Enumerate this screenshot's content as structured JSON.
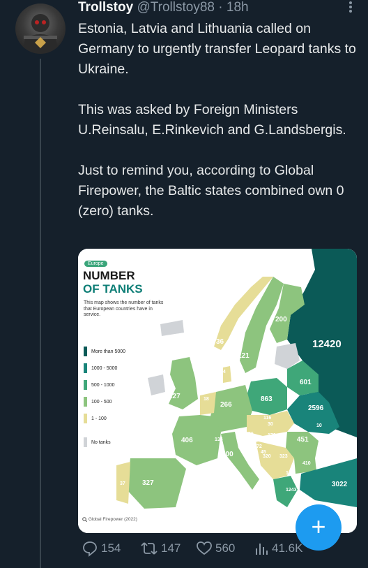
{
  "tweet": {
    "display_name": "Trollstoy",
    "handle": "@Trollstoy88",
    "separator": "·",
    "time": "18h",
    "text": "Estonia, Latvia and Lithuania called on Germany to urgently transfer Leopard tanks to Ukraine.\n\nThis was asked by Foreign Ministers U.Reinsalu, E.Rinkevich and G.Landsbergis.\n\nJust to remind you, according to Global Firepower, the Baltic states combined own 0 (zero) tanks."
  },
  "map": {
    "badge": "Europe",
    "title_line1": "NUMBER",
    "title_line2": "OF TANKS",
    "description": "This map shows the number of tanks that European countries have in service.",
    "legend": [
      {
        "label": "More than 5000",
        "color": "#0b5a57"
      },
      {
        "label": "1000 - 5000",
        "color": "#19847a"
      },
      {
        "label": "500 - 1000",
        "color": "#3fa779"
      },
      {
        "label": "100 - 500",
        "color": "#8dc47e"
      },
      {
        "label": "1 - 100",
        "color": "#e6dd97"
      },
      {
        "label": "No tanks",
        "color": "#d0d3d7"
      }
    ],
    "values": {
      "russia": "12420",
      "finland": "200",
      "sweden": "121",
      "norway": "36",
      "denmark": "44",
      "uk": "227",
      "ireland": "0",
      "netherlands": "18",
      "germany": "266",
      "poland": "863",
      "belarus": "601",
      "ukraine": "2596",
      "france": "406",
      "spain": "327",
      "portugal": "37",
      "italy": "200",
      "czechia": "116",
      "slovakia": "30",
      "austria": "56",
      "switzerland": "134",
      "hungary": "176",
      "romania": "451",
      "moldova": "10",
      "serbia": "320",
      "bulgaria": "410",
      "n_macedonia": "10",
      "greece": "1243",
      "turkey": "3022",
      "slovenia": "14",
      "croatia": "72",
      "bosnia": "45",
      "montenegro": "323"
    },
    "source": "Global Firepower (2022)"
  },
  "actions": {
    "replies": "154",
    "retweets": "147",
    "likes": "560",
    "views": "41.6K"
  },
  "fab": {
    "label": "+"
  }
}
